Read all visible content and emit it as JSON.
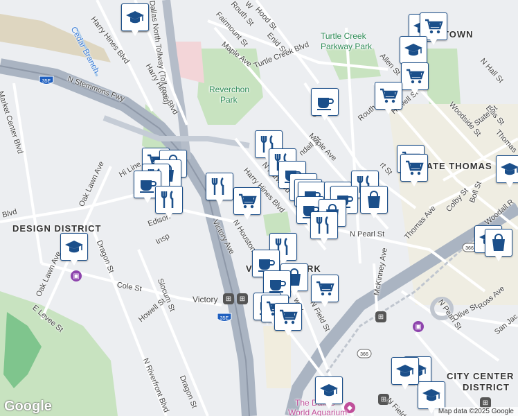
{
  "map": {
    "attribution": "Map data ©2025 Google",
    "logo": "Google",
    "colors": {
      "background": "#eceef1",
      "park": "#cfe8c4",
      "highway": "#aab4c2",
      "pin_border": "#1b4f8a",
      "pin_icon": "#1b4f8a"
    }
  },
  "labels": {
    "district_design": "DESIGN DISTRICT",
    "district_uptown": "UPTOWN",
    "district_state_thomas": "STATE THOMAS",
    "district_city_center": "CITY CENTER",
    "district_city_center2": "DISTRICT",
    "district_victory": "V",
    "district_victory2": "RK",
    "park_turtle_creek": "Turtle Creek",
    "park_turtle_creek2": "Parkway Park",
    "park_reverchon": "Reverchon",
    "park_reverchon2": "Park",
    "water_cedar": "Cedar Branch",
    "aquarium": "The Dallas",
    "aquarium2": "World Aquarium",
    "victory_station": "Victory",
    "streets": {
      "harry_hines_1": "Harry Hines Blvd",
      "harry_hines_2": "Harry Hines Blvd",
      "harry_hines_3": "Harry Hines Blvd",
      "tollway": "Dallas North Tollway (Toll road)",
      "stemmons": "N Stemmons Fwy",
      "market_center": "Market Center Blvd",
      "oak_lawn_1": "Oak Lawn Ave",
      "oak_lawn_2": "Oak Lawn Ave",
      "maple_1": "Maple Ave",
      "maple_2": "Maple Ave",
      "fairmount": "Fairmount St",
      "hood": "Hood St",
      "enid": "Enid St",
      "turtle_creek_blvd": "Turtle Creek Blvd",
      "routh": "Routh St",
      "allen": "Allen St",
      "n_hall": "N Hall St",
      "woodside": "Woodside St",
      "ellis": "Ellis St",
      "state": "State St",
      "thomas": "Thomas",
      "routh_howell": "Routh St",
      "howell": "Howell St",
      "n_harwood": "N Harwood St",
      "hi_line": "Hi Line",
      "edison": "Edison",
      "inspiration": "Insp",
      "dragon_1": "Dragon St",
      "dragon_2": "Dragon St",
      "cole": "Cole St",
      "slocum": "Slocum St",
      "howell_sw": "Howell St",
      "e_levee": "E Levee St",
      "n_riverfront": "N Riverfront Blvd",
      "victory_ave": "Victory Ave",
      "n_houston": "N Houston St",
      "n_field_1": "N Field St",
      "n_field_2": "N Field",
      "n_pearl_1": "N Pearl St",
      "n_pearl_2": "N Pearl St",
      "mckinney": "McKinney Ave",
      "thomas_ave": "Thomas Ave",
      "colby": "Colby St",
      "boll": "Boll St",
      "woodall": "Woodall R",
      "ross": "Ross Ave",
      "olive": "Olive St",
      "san_jacinto": "San Jac",
      "blvd_w": "Blvd",
      "caz": "Cal",
      "randall": "ndall St",
      "hall_st_mid": "all St",
      "rt_st": "rt St",
      "n_pearl_small": "N Pe",
      "way": "way",
      "w_st": "W"
    }
  },
  "shields": {
    "i35e_1": "35E",
    "i35e_2": "35E",
    "us366_1": "366",
    "us366_2": "366"
  },
  "pins": [
    {
      "icon": "cart-icon",
      "name": "grocery-pin"
    },
    {
      "icon": "graduation-cap-icon",
      "name": "school-pin"
    },
    {
      "icon": "cart-icon",
      "name": "grocery-pin"
    },
    {
      "icon": "graduation-cap-icon",
      "name": "school-pin"
    },
    {
      "icon": "cart-icon",
      "name": "grocery-pin"
    },
    {
      "icon": "cart-icon",
      "name": "grocery-pin"
    },
    {
      "icon": "coffee-icon",
      "name": "cafe-pin"
    },
    {
      "icon": "cart-icon",
      "name": "grocery-pin"
    },
    {
      "icon": "cart-icon",
      "name": "grocery-pin"
    },
    {
      "icon": "graduation-cap-icon",
      "name": "school-pin"
    },
    {
      "icon": "graduation-cap-icon",
      "name": "school-pin"
    },
    {
      "icon": "shopping-bag-icon",
      "name": "shopping-pin"
    },
    {
      "icon": "cart-icon",
      "name": "grocery-pin"
    },
    {
      "icon": "shopping-bag-icon",
      "name": "shopping-pin"
    },
    {
      "icon": "shopping-bag-icon",
      "name": "shopping-pin"
    },
    {
      "icon": "utensils-icon",
      "name": "restaurant-pin"
    },
    {
      "icon": "coffee-icon",
      "name": "cafe-pin"
    },
    {
      "icon": "utensils-icon",
      "name": "restaurant-pin"
    },
    {
      "icon": "utensils-icon",
      "name": "restaurant-pin"
    },
    {
      "icon": "cart-icon",
      "name": "grocery-pin"
    },
    {
      "icon": "utensils-icon",
      "name": "restaurant-pin"
    },
    {
      "icon": "utensils-icon",
      "name": "restaurant-pin"
    },
    {
      "icon": "coffee-icon",
      "name": "cafe-pin"
    },
    {
      "icon": "coffee-icon",
      "name": "cafe-pin"
    },
    {
      "icon": "cart-icon",
      "name": "grocery-pin"
    },
    {
      "icon": "coffee-icon",
      "name": "cafe-pin"
    },
    {
      "icon": "utensils-icon",
      "name": "restaurant-pin"
    },
    {
      "icon": "utensils-icon",
      "name": "restaurant-pin"
    },
    {
      "icon": "coffee-icon",
      "name": "cafe-pin"
    },
    {
      "icon": "shopping-bag-icon",
      "name": "shopping-pin"
    },
    {
      "icon": "coffee-icon",
      "name": "cafe-pin"
    },
    {
      "icon": "shopping-bag-icon",
      "name": "shopping-pin"
    },
    {
      "icon": "utensils-icon",
      "name": "restaurant-pin"
    },
    {
      "icon": "utensils-icon",
      "name": "restaurant-pin"
    },
    {
      "icon": "coffee-icon",
      "name": "cafe-pin"
    },
    {
      "icon": "shopping-bag-icon",
      "name": "shopping-pin"
    },
    {
      "icon": "cart-icon",
      "name": "grocery-pin"
    },
    {
      "icon": "coffee-icon",
      "name": "cafe-pin"
    },
    {
      "icon": "coffee-icon",
      "name": "cafe-pin"
    },
    {
      "icon": "cart-icon",
      "name": "grocery-pin"
    },
    {
      "icon": "cart-icon",
      "name": "grocery-pin"
    },
    {
      "icon": "graduation-cap-icon",
      "name": "school-pin"
    },
    {
      "icon": "graduation-cap-icon",
      "name": "school-pin"
    },
    {
      "icon": "graduation-cap-icon",
      "name": "school-pin"
    },
    {
      "icon": "graduation-cap-icon",
      "name": "school-pin"
    },
    {
      "icon": "graduation-cap-icon",
      "name": "school-pin"
    },
    {
      "icon": "graduation-cap-icon",
      "name": "school-pin"
    }
  ]
}
